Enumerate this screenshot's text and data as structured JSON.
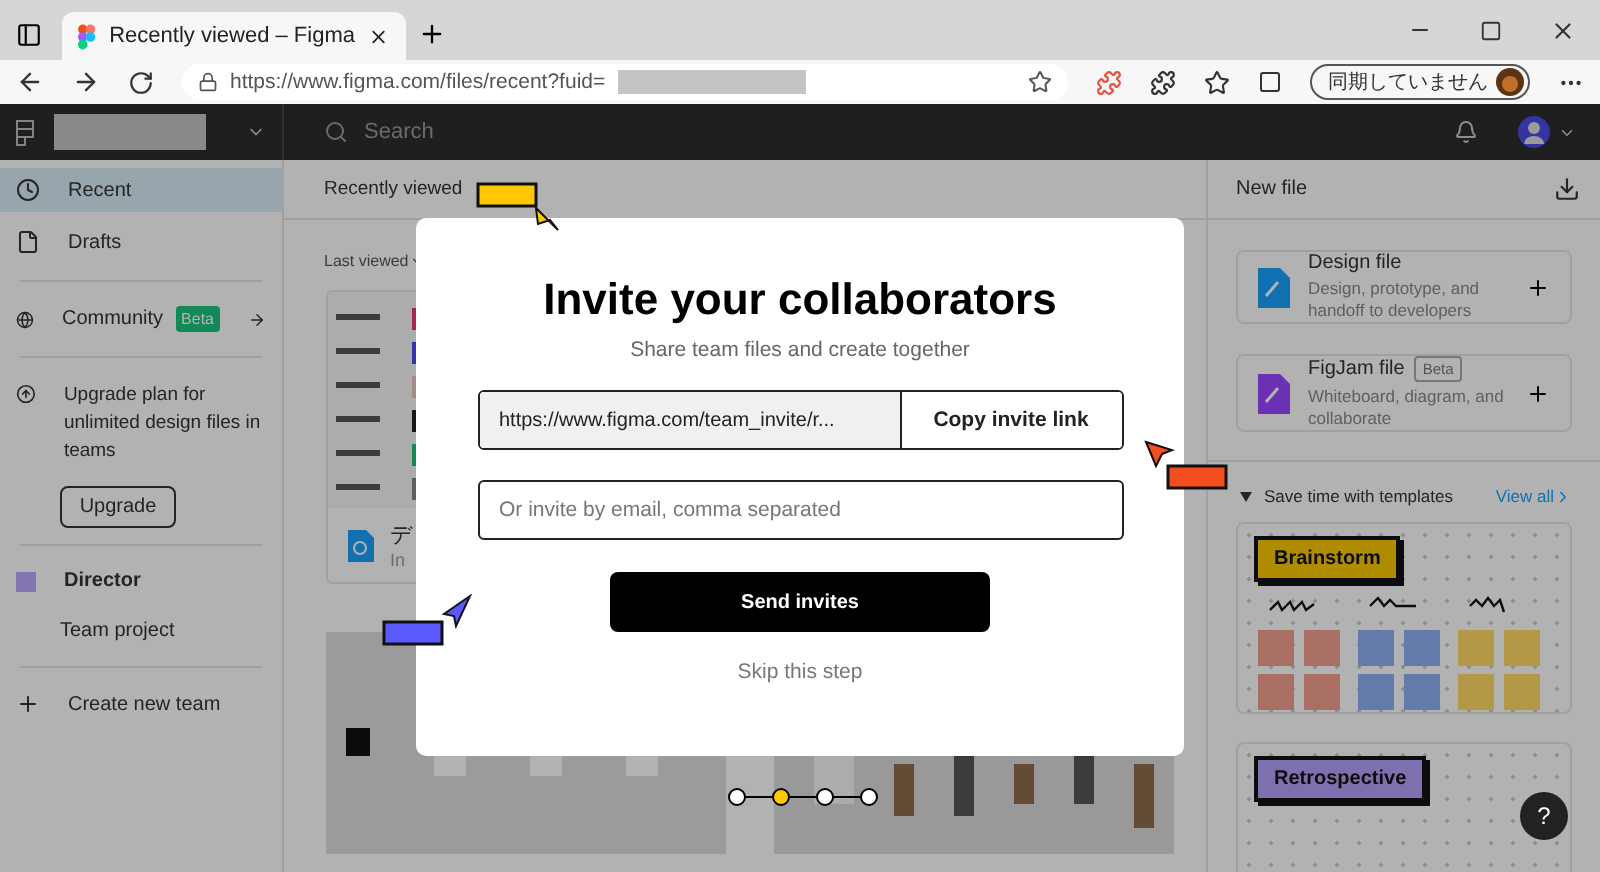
{
  "browser": {
    "tab_title": "Recently viewed – Figma",
    "url": "https://www.figma.com/files/recent?fuid=",
    "sync_label": "同期していません"
  },
  "topbar": {
    "search_placeholder": "Search"
  },
  "sidebar": {
    "nav": [
      {
        "label": "Recent",
        "selected": true
      },
      {
        "label": "Drafts",
        "selected": false
      }
    ],
    "community": {
      "label": "Community",
      "badge": "Beta"
    },
    "upgrade": {
      "text": "Upgrade plan for unlimited design files in teams",
      "button": "Upgrade"
    },
    "team": {
      "name": "Director",
      "project": "Team project"
    },
    "create_team": "Create new team"
  },
  "main": {
    "title": "Recently viewed",
    "filter": "Last viewed",
    "card": {
      "title": "デ",
      "subtitle": "In"
    }
  },
  "new_file": {
    "title": "New file",
    "files": [
      {
        "kind": "design",
        "title": "Design file",
        "description": "Design, prototype, and handoff to developers"
      },
      {
        "kind": "figjam",
        "title": "FigJam file",
        "badge": "Beta",
        "description": "Whiteboard, diagram, and collaborate"
      }
    ],
    "templates_title": "Save time with templates",
    "view_all": "View all",
    "templates": [
      {
        "label": "Brainstorm",
        "color": "#af8c00"
      },
      {
        "label": "Retrospective",
        "color": "#7e70af"
      }
    ],
    "help": "?"
  },
  "modal": {
    "title": "Invite your collaborators",
    "subtitle": "Share team files and create together",
    "invite_link": "https://www.figma.com/team_invite/r...",
    "copy_button": "Copy invite link",
    "email_placeholder": "Or invite by email, comma separated",
    "send_button": "Send invites",
    "skip": "Skip this step"
  },
  "steps": [
    {
      "selected": false
    },
    {
      "selected": true
    },
    {
      "selected": false
    },
    {
      "selected": false
    }
  ],
  "cursors": [
    {
      "color": "#ffc700"
    },
    {
      "color": "#5a5aff"
    },
    {
      "color": "#f24e1e"
    }
  ]
}
